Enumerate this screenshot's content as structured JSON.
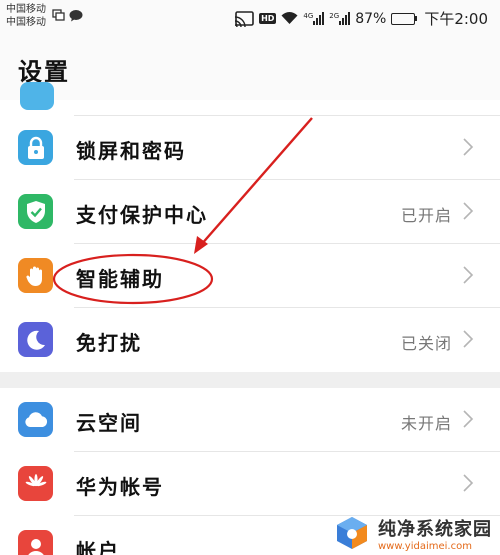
{
  "status_bar": {
    "carrier_1": "中国移动",
    "carrier_2": "中国移动",
    "hd": "HD",
    "net_1": "4G",
    "net_2": "2G",
    "battery": "87%",
    "battery_level": 0.87,
    "time": "下午2:00"
  },
  "header": {
    "title": "设置"
  },
  "rows": [
    {
      "label": "锁屏和密码",
      "value": "",
      "icon": "lock-icon",
      "color": "#3aa6e0"
    },
    {
      "label": "支付保护中心",
      "value": "已开启",
      "icon": "shield-check-icon",
      "color": "#2fb866"
    },
    {
      "label": "智能辅助",
      "value": "",
      "icon": "hand-icon",
      "color": "#f08a24"
    },
    {
      "label": "免打扰",
      "value": "已关闭",
      "icon": "moon-icon",
      "color": "#5b62d9"
    },
    {
      "label": "云空间",
      "value": "未开启",
      "icon": "cloud-icon",
      "color": "#3d8fe0"
    },
    {
      "label": "华为帐号",
      "value": "",
      "icon": "huawei-logo-icon",
      "color": "#e8453c"
    },
    {
      "label": "帐户",
      "value": "",
      "icon": "user-icon",
      "color": "#e8453c"
    }
  ],
  "annotation": {
    "color": "#d8201e"
  },
  "watermark": {
    "title": "纯净系统家园",
    "url": "www.yidaimei.com"
  }
}
